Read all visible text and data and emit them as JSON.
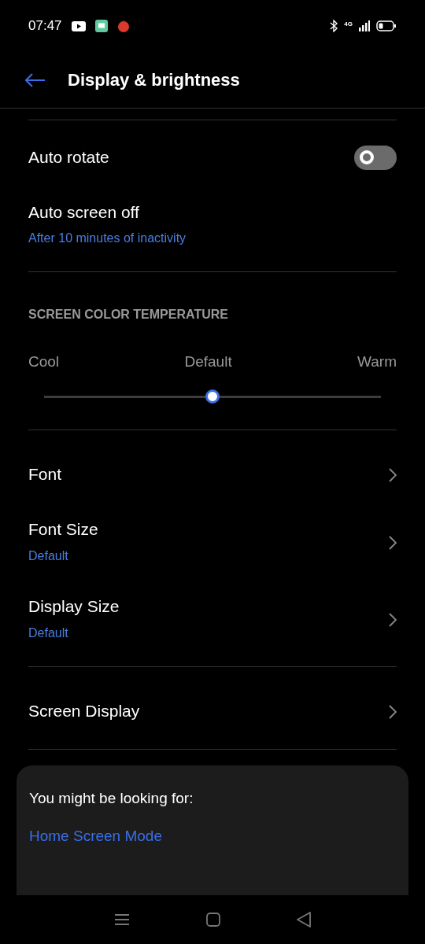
{
  "status_bar": {
    "time": "07:47",
    "network": "4G"
  },
  "header": {
    "title": "Display & brightness"
  },
  "groups": [
    {
      "items": [
        {
          "kind": "toggle",
          "label": "Auto rotate",
          "on": false
        },
        {
          "kind": "info",
          "label": "Auto screen off",
          "value": "After 10 minutes of inactivity"
        }
      ]
    },
    {
      "heading": "SCREEN COLOR TEMPERATURE",
      "slider": {
        "labels": [
          "Cool",
          "Default",
          "Warm"
        ],
        "level": 0.5
      }
    },
    {
      "items": [
        {
          "kind": "link",
          "label": "Font"
        },
        {
          "kind": "link",
          "label": "Font Size",
          "value": "Default"
        },
        {
          "kind": "link",
          "label": "Display Size",
          "value": "Default"
        }
      ]
    },
    {
      "items": [
        {
          "kind": "link",
          "label": "Screen Display"
        }
      ]
    }
  ],
  "suggestions": {
    "title": "You might be looking for:",
    "links": [
      "Home Screen Mode"
    ]
  }
}
